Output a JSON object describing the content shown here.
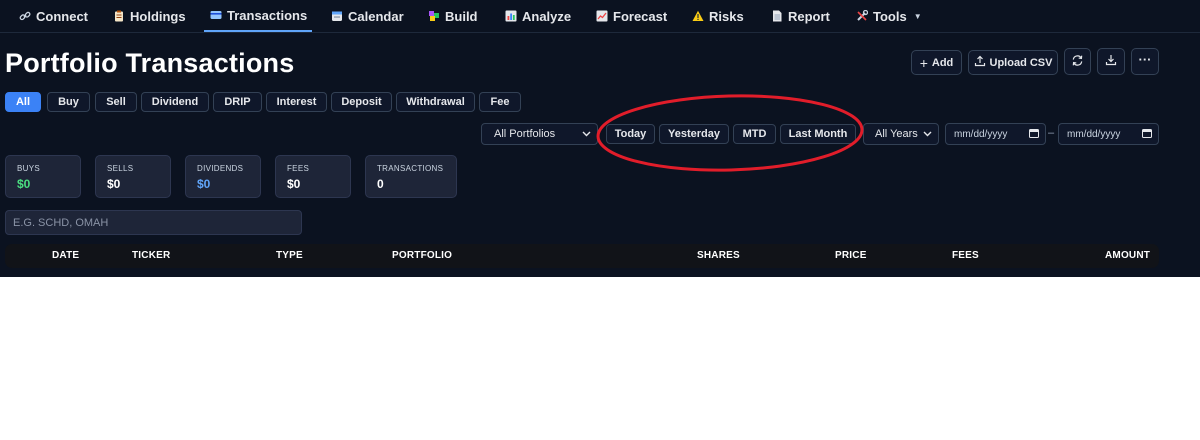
{
  "nav": {
    "items": [
      {
        "label": "Connect",
        "icon": "link-icon"
      },
      {
        "label": "Holdings",
        "icon": "clipboard-icon"
      },
      {
        "label": "Transactions",
        "icon": "credit-card-icon"
      },
      {
        "label": "Calendar",
        "icon": "calendar-icon"
      },
      {
        "label": "Build",
        "icon": "blocks-icon"
      },
      {
        "label": "Analyze",
        "icon": "bar-chart-icon"
      },
      {
        "label": "Forecast",
        "icon": "trend-chart-icon"
      },
      {
        "label": "Risks",
        "icon": "warning-icon"
      },
      {
        "label": "Report",
        "icon": "document-icon"
      },
      {
        "label": "Tools",
        "icon": "tools-icon"
      }
    ],
    "active": "Transactions"
  },
  "page": {
    "title": "Portfolio Transactions"
  },
  "actions": {
    "add_label": "Add",
    "upload_label": "Upload CSV"
  },
  "filters": {
    "types": [
      "All",
      "Buy",
      "Sell",
      "Dividend",
      "DRIP",
      "Interest",
      "Deposit",
      "Withdrawal",
      "Fee"
    ],
    "active_type": "All",
    "portfolio_select": "All Portfolios",
    "quick_ranges": [
      "Today",
      "Yesterday",
      "MTD",
      "Last Month"
    ],
    "year_select": "All Years",
    "date_from_placeholder": "mm/dd/yyyy",
    "date_to_placeholder": "mm/dd/yyyy",
    "date_separator": "–"
  },
  "stats": [
    {
      "label": "BUYS",
      "value": "$0",
      "color": "#4ade80"
    },
    {
      "label": "SELLS",
      "value": "$0",
      "color": "#ffffff"
    },
    {
      "label": "DIVIDENDS",
      "value": "$0",
      "color": "#60a5fa"
    },
    {
      "label": "FEES",
      "value": "$0",
      "color": "#ffffff"
    },
    {
      "label": "TRANSACTIONS",
      "value": "0",
      "color": "#ffffff"
    }
  ],
  "search": {
    "placeholder": "E.G. SCHD, OMAH"
  },
  "table": {
    "columns": [
      "DATE",
      "TICKER",
      "TYPE",
      "PORTFOLIO",
      "SHARES",
      "PRICE",
      "FEES",
      "AMOUNT"
    ]
  },
  "colors": {
    "background": "#0b1220",
    "accent": "#3b82f6",
    "annotation": "#e11d2a"
  }
}
